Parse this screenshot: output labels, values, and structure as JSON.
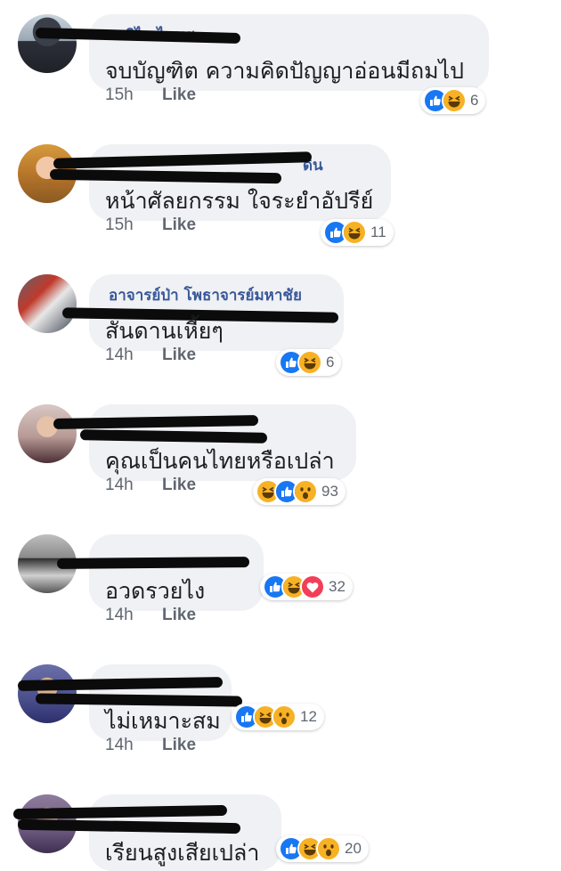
{
  "colors": {
    "like_blue": "#1877f2",
    "haha_yellow": "#f7b125",
    "love_red": "#f33e58",
    "bubble_bg": "#f0f1f4",
    "meta_gray": "#606770"
  },
  "like_label": "Like",
  "comments": [
    {
      "author_visible": "ซิไล ไนมส",
      "text": "จบบัญฑิต ความคิดปัญญาอ่อนมีถมไป",
      "time": "15h",
      "reactions": [
        "like",
        "haha"
      ],
      "reaction_count": "6"
    },
    {
      "author_visible": "ดิน",
      "text": "หน้าศัลยกรรม ใจระยำอัปรีย์",
      "time": "15h",
      "reactions": [
        "like",
        "haha"
      ],
      "reaction_count": "11"
    },
    {
      "author_visible": "อาจารย์ป่า โพธาจารย์มหาชัย",
      "text": "สันดานเหี้ยๆ",
      "time": "14h",
      "reactions": [
        "like",
        "haha"
      ],
      "reaction_count": "6"
    },
    {
      "author_visible": "",
      "text": "คุณเป็นคนไทยหรือเปล่า",
      "time": "14h",
      "reactions": [
        "haha",
        "like",
        "wow"
      ],
      "reaction_count": "93"
    },
    {
      "author_visible": "",
      "text": "อวดรวยไง",
      "time": "14h",
      "reactions": [
        "like",
        "haha",
        "love"
      ],
      "reaction_count": "32"
    },
    {
      "author_visible": "",
      "text": "ไม่เหมาะสม",
      "time": "14h",
      "reactions": [
        "like",
        "haha",
        "wow"
      ],
      "reaction_count": "12"
    },
    {
      "author_visible": "",
      "text": "เรียนสูงเสียเปล่า",
      "time": "",
      "reactions": [
        "like",
        "haha",
        "wow"
      ],
      "reaction_count": "20"
    }
  ]
}
